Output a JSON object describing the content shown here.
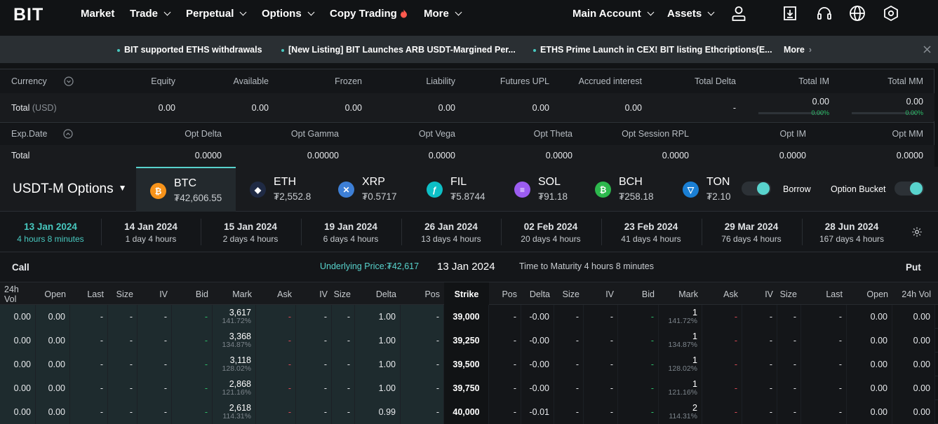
{
  "brand": {
    "logo": "BIT"
  },
  "nav": {
    "market": "Market",
    "trade": "Trade",
    "perpetual": "Perpetual",
    "options": "Options",
    "copy_trading": "Copy Trading",
    "more": "More",
    "main_account": "Main Account",
    "assets": "Assets"
  },
  "announcements": {
    "items": [
      "BIT supported ETHS withdrawals",
      "[New Listing] BIT Launches ARB USDT-Margined Per...",
      "ETHS Prime Launch in CEX! BIT listing Ethcriptions(E..."
    ],
    "more": "More"
  },
  "account": {
    "headers": [
      "Currency",
      "Equity",
      "Available",
      "Frozen",
      "Liability",
      "Futures UPL",
      "Accrued interest",
      "Total Delta",
      "Total IM",
      "Total MM"
    ],
    "total_label": "Total",
    "total_unit": "(USD)",
    "values": [
      "0.00",
      "0.00",
      "0.00",
      "0.00",
      "0.00",
      "0.00",
      "-",
      "0.00",
      "0.00"
    ],
    "im_pct": "0.00%",
    "mm_pct": "0.00%",
    "opt_headers": [
      "Exp.Date",
      "Opt Delta",
      "Opt Gamma",
      "Opt Vega",
      "Opt Theta",
      "Opt Session RPL",
      "Opt IM",
      "Opt MM"
    ],
    "opt_total_label": "Total",
    "opt_values": [
      "0.0000",
      "0.00000",
      "0.0000",
      "0.0000",
      "0.0000",
      "0.0000",
      "0.0000"
    ]
  },
  "market": {
    "selector": "USDT-M Options",
    "borrow": "Borrow",
    "bucket": "Option Bucket"
  },
  "coins": [
    {
      "name": "BTC",
      "price": "₮42,606.55",
      "color": "#f7931a",
      "glyph": "₿"
    },
    {
      "name": "ETH",
      "price": "₮2,552.8",
      "color": "#1f2a44",
      "glyph": "◆"
    },
    {
      "name": "XRP",
      "price": "₮0.5717",
      "color": "#3d7fd6",
      "glyph": "✕"
    },
    {
      "name": "FIL",
      "price": "₮5.8744",
      "color": "#0dbfc6",
      "glyph": "ƒ"
    },
    {
      "name": "SOL",
      "price": "₮91.18",
      "color": "#9b5cf0",
      "glyph": "≡"
    },
    {
      "name": "BCH",
      "price": "₮258.18",
      "color": "#2db84d",
      "glyph": "₿"
    },
    {
      "name": "TON",
      "price": "₮2.10",
      "color": "#1a7fd4",
      "glyph": "▽"
    }
  ],
  "dates": [
    {
      "date": "13 Jan 2024",
      "time": "4 hours 8 minutes"
    },
    {
      "date": "14 Jan 2024",
      "time": "1 day 4 hours"
    },
    {
      "date": "15 Jan 2024",
      "time": "2 days 4 hours"
    },
    {
      "date": "19 Jan 2024",
      "time": "6 days 4 hours"
    },
    {
      "date": "26 Jan 2024",
      "time": "13 days 4 hours"
    },
    {
      "date": "02 Feb 2024",
      "time": "20 days 4 hours"
    },
    {
      "date": "23 Feb 2024",
      "time": "41 days 4 hours"
    },
    {
      "date": "29 Mar 2024",
      "time": "76 days 4 hours"
    },
    {
      "date": "28 Jun 2024",
      "time": "167 days 4 hours"
    }
  ],
  "info": {
    "call": "Call",
    "underlying": "Underlying Price:₮42,617",
    "expiry": "13 Jan 2024",
    "maturity": "Time to Maturity 4 hours 8 minutes",
    "put": "Put"
  },
  "columns": [
    "24h Vol",
    "Open",
    "Last",
    "Size",
    "IV",
    "Bid",
    "Mark",
    "Ask",
    "IV",
    "Size",
    "Delta",
    "Pos",
    "Strike",
    "Pos",
    "Delta",
    "Size",
    "IV",
    "Bid",
    "Mark",
    "Ask",
    "IV",
    "Size",
    "Last",
    "Open",
    "24h Vol"
  ],
  "rows": [
    {
      "strike": "39,000",
      "call_mark": "3,617",
      "call_iv": "141.72%",
      "call_delta": "1.00",
      "put_mark": "1",
      "put_iv": "141.72%",
      "put_delta": "-0.00"
    },
    {
      "strike": "39,250",
      "call_mark": "3,368",
      "call_iv": "134.87%",
      "call_delta": "1.00",
      "put_mark": "1",
      "put_iv": "134.87%",
      "put_delta": "-0.00"
    },
    {
      "strike": "39,500",
      "call_mark": "3,118",
      "call_iv": "128.02%",
      "call_delta": "1.00",
      "put_mark": "1",
      "put_iv": "128.02%",
      "put_delta": "-0.00"
    },
    {
      "strike": "39,750",
      "call_mark": "2,868",
      "call_iv": "121.16%",
      "call_delta": "1.00",
      "put_mark": "1",
      "put_iv": "121.16%",
      "put_delta": "-0.00"
    },
    {
      "strike": "40,000",
      "call_mark": "2,618",
      "call_iv": "114.31%",
      "call_delta": "0.99",
      "put_mark": "2",
      "put_iv": "114.31%",
      "put_delta": "-0.01"
    }
  ],
  "cell": {
    "zero": "0.00",
    "dash": "-"
  }
}
